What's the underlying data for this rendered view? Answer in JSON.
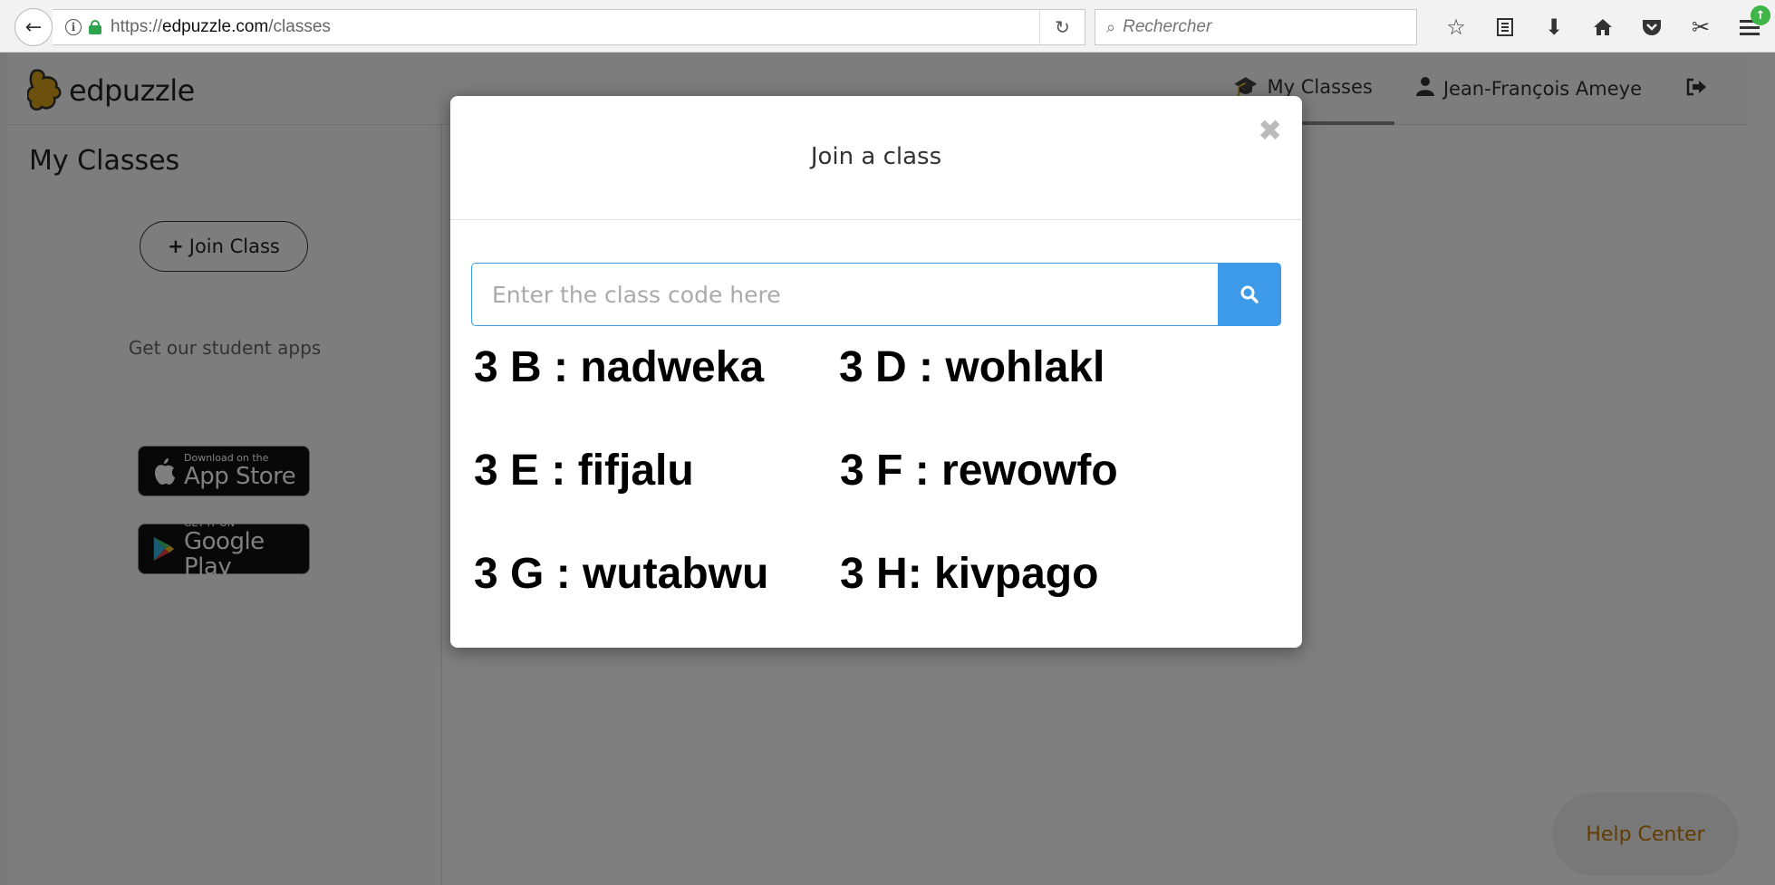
{
  "browser": {
    "url_scheme": "https://",
    "url_domain": "edpuzzle.com",
    "url_path": "/classes",
    "search_placeholder": "Rechercher"
  },
  "app": {
    "logo_text": "edpuzzle",
    "nav": {
      "my_classes": "My Classes",
      "user_name": "Jean-François Ameye"
    },
    "sidebar": {
      "title": "My Classes",
      "join_button": "Join Class",
      "apps_label": "Get our student apps",
      "app_store": {
        "small": "Download on the",
        "big": "App Store"
      },
      "google_play": {
        "small": "GET IT ON",
        "big": "Google Play"
      }
    },
    "help_center": "Help Center"
  },
  "modal": {
    "title": "Join a class",
    "input_placeholder": "Enter the class code here",
    "class_codes": [
      "3 B : nadweka",
      "3 D : wohlakl",
      "3 E : fifjalu",
      "3 F : rewowfo",
      "3 G : wutabwu",
      "3 H: kivpago"
    ]
  },
  "colors": {
    "accent_blue": "#3c9ae8",
    "help_orange": "#c47a00",
    "lock_green": "#2ea44f"
  }
}
